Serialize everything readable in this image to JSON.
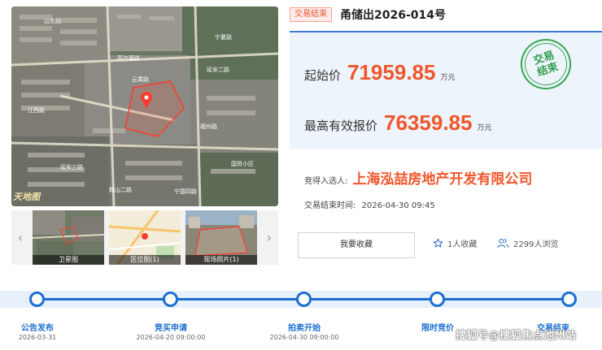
{
  "media": {
    "map_labels": [
      "山东路",
      "云霄路",
      "高尔基路",
      "江西路",
      "福州路",
      "延安二路",
      "宁夏路",
      "宁国四路",
      "鞍山二路",
      "国贸小区",
      "延安三路"
    ],
    "watermark": "天地图",
    "thumbs": [
      {
        "caption": "卫星图",
        "icon": "satellite-thumb"
      },
      {
        "caption": "区位图(1)",
        "icon": "location-map-thumb"
      },
      {
        "caption": "现场照片(1)",
        "icon": "site-photo-thumb"
      }
    ],
    "prev_icon": "‹",
    "next_icon": "›"
  },
  "header": {
    "status": "交易结束",
    "title": "甬储出2026-014号"
  },
  "price": {
    "start_label": "起始价",
    "start_value": "71959.85",
    "start_unit": "万元",
    "max_label": "最高有效报价",
    "max_value": "76359.85",
    "max_unit": "万元",
    "stamp_line1": "交易",
    "stamp_line2": "结束"
  },
  "winner": {
    "label": "竞得入选人:",
    "value": "上海泓喆房地产开发有限公司"
  },
  "end_time": {
    "label": "交易结束时间:",
    "value": "2026-04-30 09:45"
  },
  "actions": {
    "favorite_button": "我要收藏",
    "favorites": "1人收藏",
    "views": "2299人浏览"
  },
  "timeline": [
    {
      "label": "公告发布",
      "date": "2026-03-31"
    },
    {
      "label": "竞买申请",
      "date": "2026-04-20 09:00:00"
    },
    {
      "label": "拍卖开始",
      "date": "2026-04-30 09:00:00"
    },
    {
      "label": "限时竞价",
      "date": ""
    },
    {
      "label": "交易结束",
      "date": ""
    }
  ],
  "credit": "搜狐号@搜狐焦点池州站",
  "colors": {
    "accent": "#1c6fd1",
    "price": "#f0562b",
    "stamp": "#34a853",
    "status_tag": "#e8542f"
  }
}
